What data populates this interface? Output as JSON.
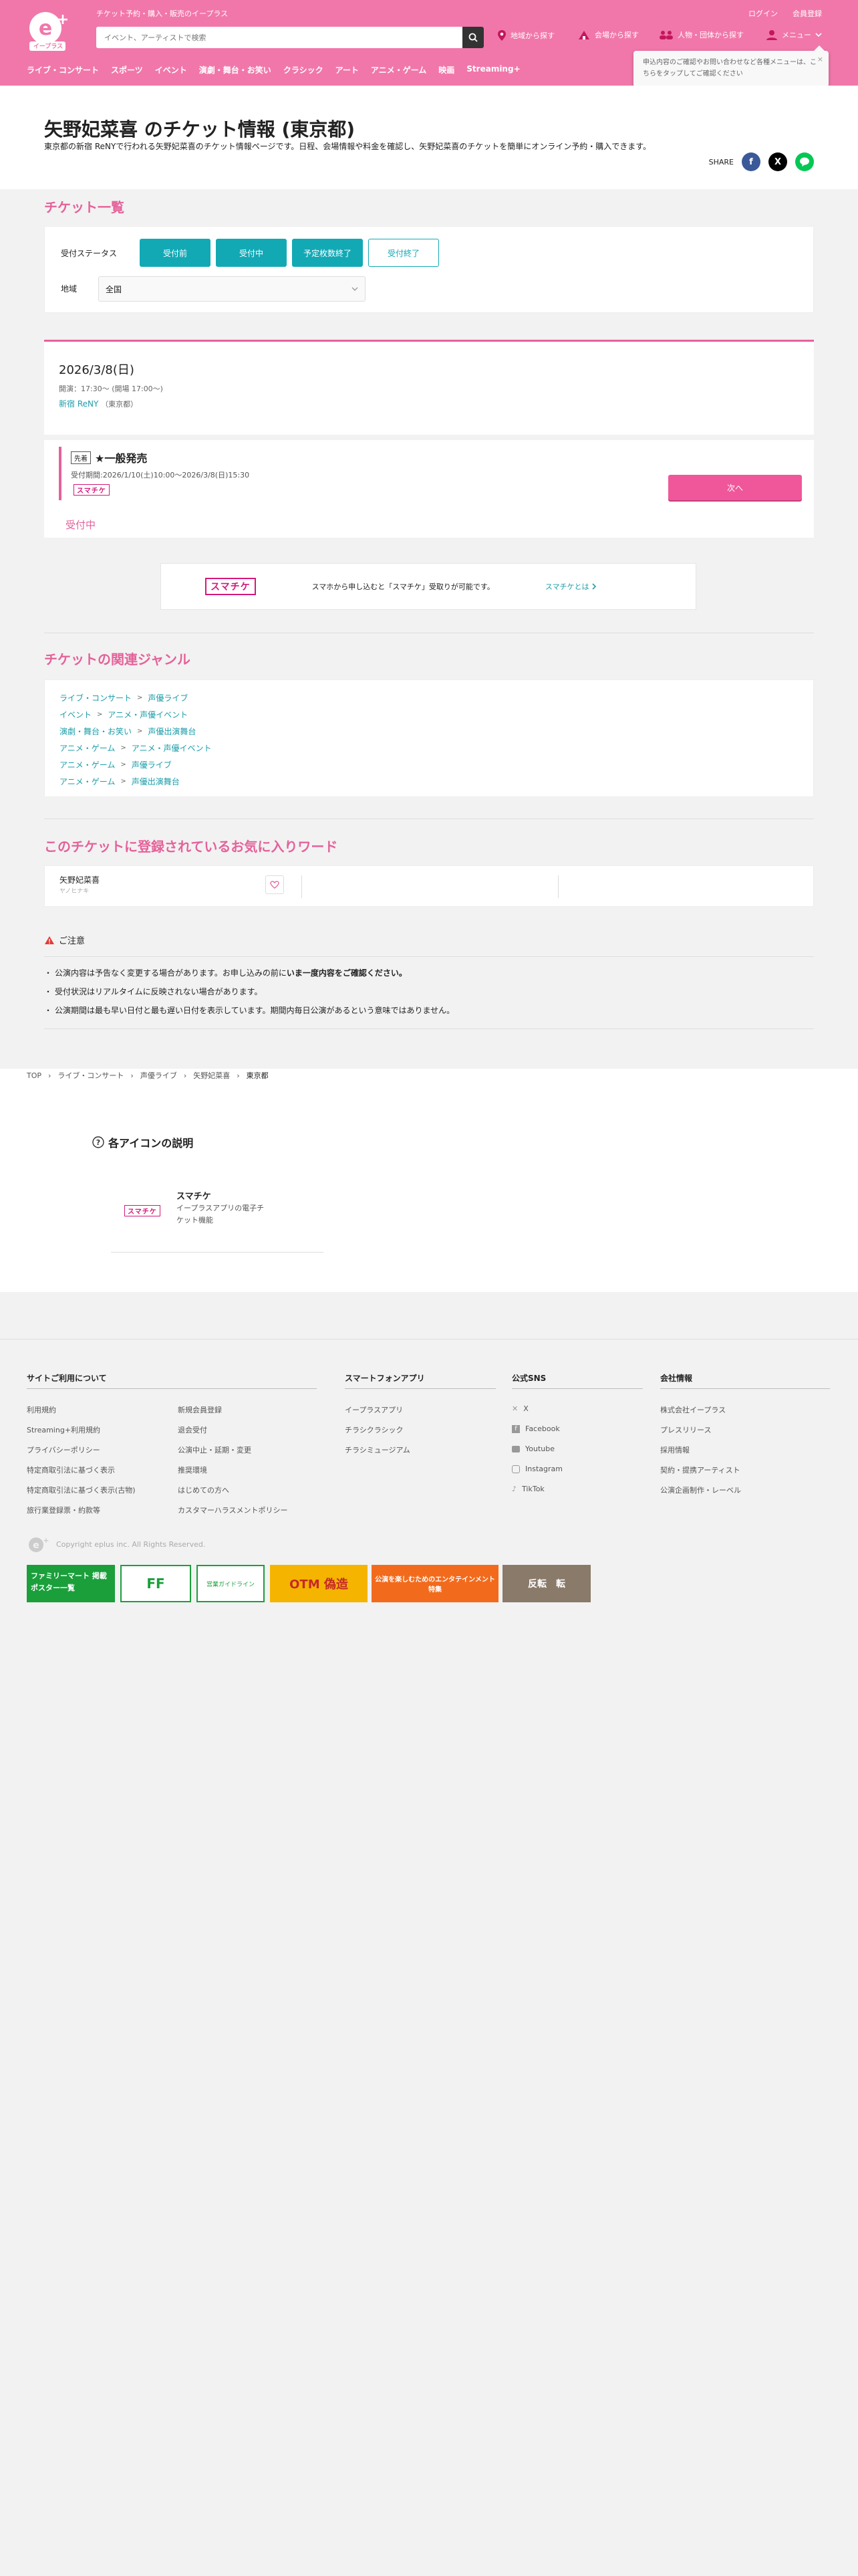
{
  "header": {
    "tagline": "チケット予約・購入・販売のイープラス",
    "logo_text": "イープラス",
    "search_placeholder": "イベント、アーティストで検索",
    "login": "ログイン",
    "register": "会員登録",
    "nav_area": "地域から探す",
    "nav_venue": "会場から探す",
    "nav_people": "人物・団体から探す",
    "nav_menu": "メニュー",
    "categories": [
      "ライブ・コンサート",
      "スポーツ",
      "イベント",
      "演劇・舞台・お笑い",
      "クラシック",
      "アート",
      "アニメ・ゲーム",
      "映画",
      "Streaming+"
    ],
    "tooltip": "申込内容のご確認やお問い合わせなど各種メニューは、こちらをタップしてご確認ください"
  },
  "page": {
    "title": "矢野妃菜喜 のチケット情報 (東京都)",
    "description": "東京都の新宿 ReNYで行われる矢野妃菜喜のチケット情報ページです。日程、会場情報や料金を確認し、矢野妃菜喜のチケットを簡単にオンライン予約・購入できます。",
    "share_label": "SHARE"
  },
  "ticket_list": {
    "title": "チケット一覧",
    "status_label": "受付ステータス",
    "status_buttons": [
      "受付前",
      "受付中",
      "予定枚数終了",
      "受付終了"
    ],
    "area_label": "地域",
    "area_value": "全国"
  },
  "event": {
    "date": "2026/3/8(日)",
    "time": "開演：17:30〜 (開場 17:00〜)",
    "venue": "新宿 ReNY",
    "venue_pref": "（東京都）"
  },
  "ticket": {
    "badge": "先着",
    "name": "★一般発売",
    "period": "受付期間:2026/1/10(土)10:00〜2026/3/8(日)15:30",
    "smatike": "スマチケ",
    "status": "受付中",
    "next": "次へ"
  },
  "smatike_info": {
    "logo": "スマチケ",
    "text": "スマホから申し込むと「スマチケ」受取りが可能です。",
    "link": "スマチケとは"
  },
  "genres": {
    "title": "チケットの関連ジャンル",
    "rows": [
      [
        "ライブ・コンサート",
        "声優ライブ"
      ],
      [
        "イベント",
        "アニメ・声優イベント"
      ],
      [
        "演劇・舞台・お笑い",
        "声優出演舞台"
      ],
      [
        "アニメ・ゲーム",
        "アニメ・声優イベント"
      ],
      [
        "アニメ・ゲーム",
        "声優ライブ"
      ],
      [
        "アニメ・ゲーム",
        "声優出演舞台"
      ]
    ]
  },
  "favorites": {
    "title": "このチケットに登録されているお気に入りワード",
    "name": "矢野妃菜喜",
    "kana": "ヤノヒナキ"
  },
  "notice": {
    "title": "ご注意",
    "items": [
      {
        "pre": "公演内容は予告なく変更する場合があります。お申し込みの前に",
        "bold": "いま一度内容をご確認ください。"
      },
      {
        "pre": "受付状況はリアルタイムに反映されない場合があります。",
        "bold": ""
      },
      {
        "pre": "公演期間は最も早い日付と最も遅い日付を表示しています。期間内毎日公演があるという意味ではありません。",
        "bold": ""
      }
    ]
  },
  "breadcrumb": [
    "TOP",
    "ライブ・コンサート",
    "声優ライブ",
    "矢野妃菜喜",
    "東京都"
  ],
  "icons_help": {
    "title": "各アイコンの説明",
    "name": "スマチケ",
    "desc": "イープラスアプリの電子チケット機能",
    "logo": "スマチケ"
  },
  "footer": {
    "col1_title": "サイトご利用について",
    "col1a": [
      "利用規約",
      "Streaming+利用規約",
      "プライバシーポリシー",
      "特定商取引法に基づく表示",
      "特定商取引法に基づく表示(古物)",
      "旅行業登録票・約款等"
    ],
    "col1b": [
      "新規会員登録",
      "退会受付",
      "公演中止・延期・変更",
      "推奨環境",
      "はじめての方へ",
      "カスタマーハラスメントポリシー"
    ],
    "col2_title": "スマートフォンアプリ",
    "col2": [
      "イープラスアプリ",
      "チラシクラシック",
      "チラシミュージアム"
    ],
    "col3_title": "公式SNS",
    "col3": [
      "X",
      "Facebook",
      "Youtube",
      "Instagram",
      "TikTok"
    ],
    "col4_title": "会社情報",
    "col4": [
      "株式会社イープラス",
      "プレスリリース",
      "採用情報",
      "契約・提携アーティスト",
      "公演企画制作・レーベル"
    ],
    "copyright": "Copyright eplus inc. All Rights Reserved.",
    "banners": [
      "ファミリーマート 掲載ポスター一覧",
      "FF",
      "営業ガイドライン",
      "OTM 偽造",
      "公演を楽しむためのエンタテインメント特集",
      "反転　転"
    ]
  },
  "colors": {
    "brand_pink": "#f177aa",
    "section_pink": "#e5619a",
    "teal": "#12a9b5",
    "next_button": "#f0579a"
  }
}
